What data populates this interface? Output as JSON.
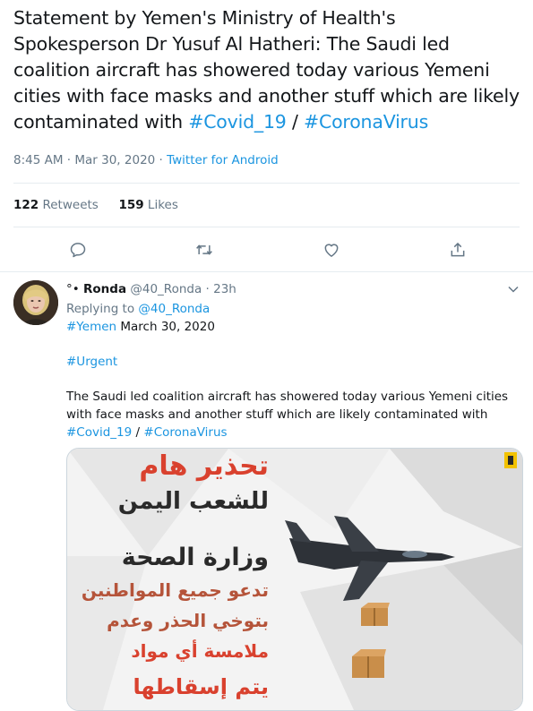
{
  "tweet": {
    "text_pre": "Statement by Yemen's Ministry of Health's Spokesperson Dr Yusuf Al Hatheri: The Saudi led coalition aircraft has showered today various Yemeni cities with face masks and another stuff which are likely contaminated with ",
    "hashtag1": "#Covid_19",
    "slash": " / ",
    "hashtag2": "#CoronaVirus",
    "time": "8:45 AM · Mar 30, 2020 · ",
    "source": "Twitter for Android",
    "retweet_count": "122",
    "retweet_label": " Retweets",
    "like_count": "159",
    "like_label": " Likes"
  },
  "actions": {
    "reply_icon": "reply-icon",
    "retweet_icon": "retweet-icon",
    "like_icon": "heart-icon",
    "share_icon": "share-icon"
  },
  "reply_tweet": {
    "name_prefix": "°•",
    "name": "Ronda",
    "handle": "@40_Ronda",
    "sep": " · ",
    "age": "23h",
    "replying_to_label": "Replying to ",
    "replying_to_handle": "@40_Ronda",
    "hashtag_yemen": "#Yemen",
    "date_text": " March 30, 2020",
    "hashtag_urgent": "#Urgent",
    "body": "The Saudi led coalition aircraft has showered today various Yemeni cities with face masks and another stuff which are likely contaminated with ",
    "hashtag1": "#Covid_19",
    "slash": " / ",
    "hashtag2": "#CoronaVirus"
  },
  "image_text": {
    "line1": "تحذير هام",
    "line2": "للشعب اليمن",
    "line3": "وزارة الصحة",
    "line4": "تدعو جميع المواطنين",
    "line5": "بتوخي الحذر وعدم",
    "line6": "ملامسة أي مواد",
    "line7": "يتم إسقاطها"
  },
  "colors": {
    "link": "#1b95e0",
    "muted": "#657786",
    "text": "#14171a",
    "border": "#e6ecf0"
  }
}
